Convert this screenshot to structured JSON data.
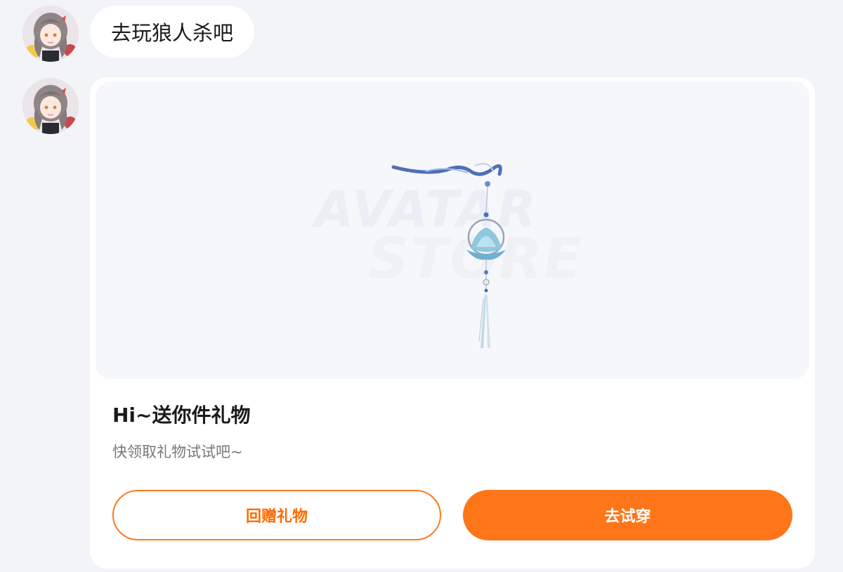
{
  "messages": [
    {
      "type": "text",
      "text": "去玩狼人杀吧"
    },
    {
      "type": "gift_card",
      "watermark_line1": "AVATAR",
      "watermark_line2": "STORE",
      "title": "Hi~送你件礼物",
      "subtitle": "快领取礼物试试吧~",
      "buttons": {
        "return_gift": "回赠礼物",
        "try_on": "去试穿"
      }
    }
  ],
  "colors": {
    "accent": "#ff7519",
    "background": "#f3f4f8",
    "card": "#ffffff"
  },
  "icons": {
    "avatar": "sender-avatar",
    "gift_item": "tassel-pendant-image"
  }
}
